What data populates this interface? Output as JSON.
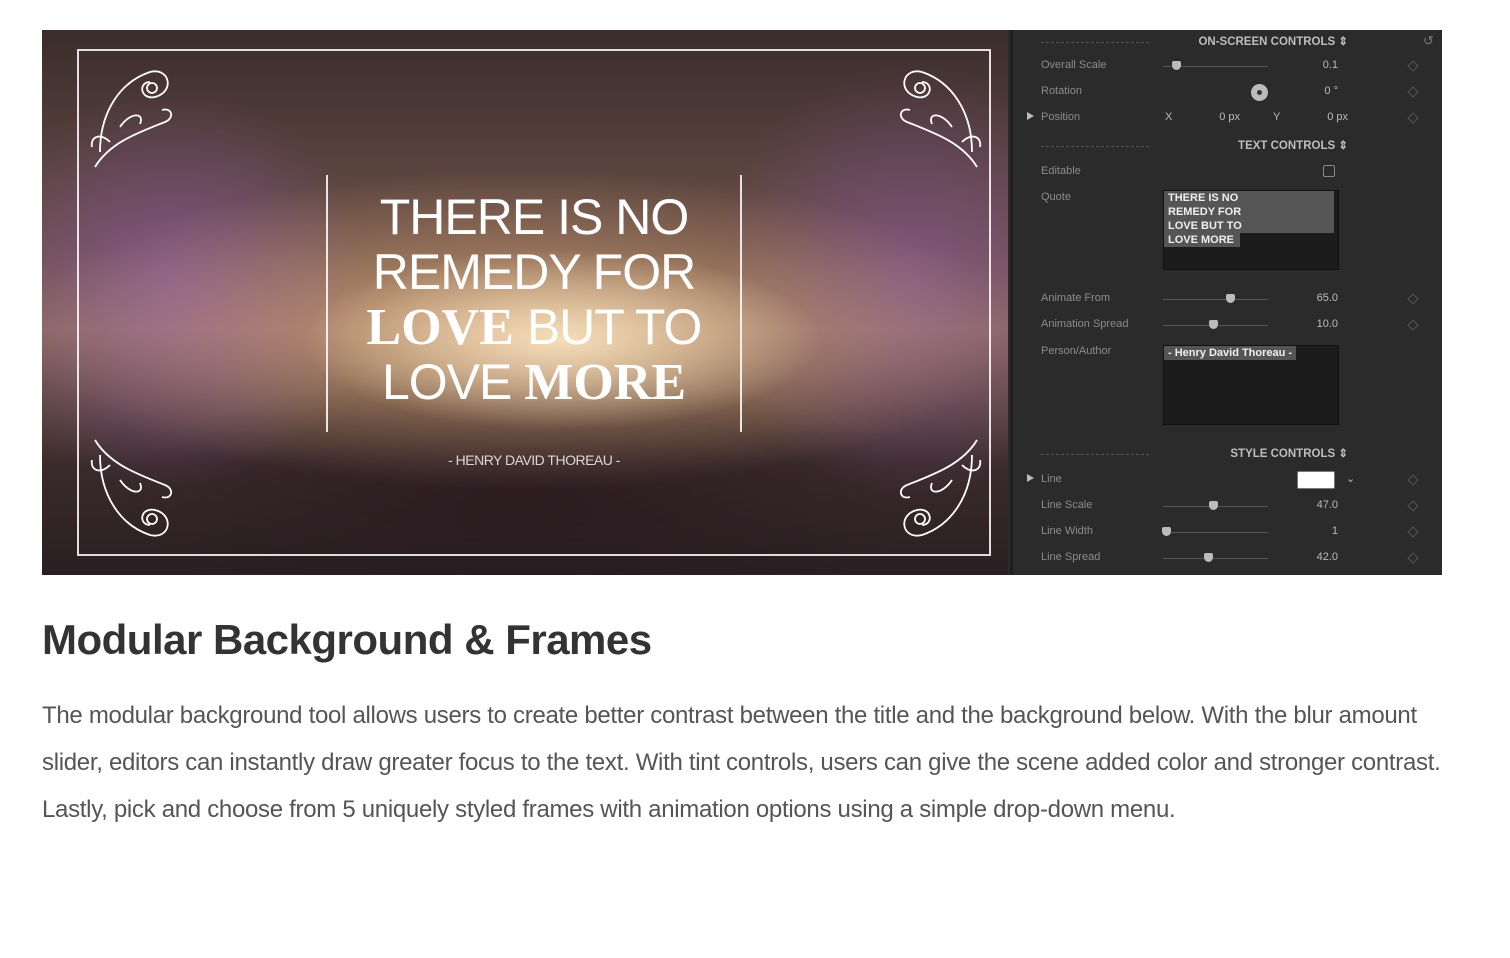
{
  "preview": {
    "quote_lines": [
      {
        "light": "THERE IS NO",
        "bold": ""
      },
      {
        "light": "REMEDY FOR",
        "bold": ""
      },
      {
        "bold": "LOVE",
        "light": " BUT TO"
      },
      {
        "light": "LOVE ",
        "bold": "MORE"
      }
    ],
    "author": "- HENRY DAVID THOREAU -"
  },
  "panel": {
    "on_screen": {
      "title": "ON-SCREEN CONTROLS ⇕",
      "reset_icon": "undo-icon",
      "overall_scale": {
        "label": "Overall Scale",
        "value": "0.1",
        "level": 0.12
      },
      "rotation": {
        "label": "Rotation",
        "value": "0 °"
      },
      "position": {
        "label": "Position",
        "x_label": "X",
        "x_value": "0 px",
        "y_label": "Y",
        "y_value": "0 px"
      }
    },
    "text": {
      "title": "TEXT CONTROLS ⇕",
      "editable": {
        "label": "Editable",
        "checked": false
      },
      "quote": {
        "label": "Quote",
        "lines": [
          "THERE IS NO",
          "REMEDY FOR",
          "LOVE BUT TO",
          "LOVE MORE"
        ]
      },
      "animate_from": {
        "label": "Animate From",
        "value": "65.0",
        "level": 0.64
      },
      "animation_spread": {
        "label": "Animation Spread",
        "value": "10.0",
        "level": 0.48
      },
      "author": {
        "label": "Person/Author",
        "value": "- Henry David Thoreau -"
      }
    },
    "style": {
      "title": "STYLE CONTROLS ⇕",
      "line": {
        "label": "Line",
        "color": "#ffffff"
      },
      "line_scale": {
        "label": "Line Scale",
        "value": "47.0",
        "level": 0.48
      },
      "line_width": {
        "label": "Line Width",
        "value": "1",
        "level": 0.03
      },
      "line_spread": {
        "label": "Line Spread",
        "value": "42.0",
        "level": 0.43
      }
    }
  },
  "article": {
    "title": "Modular Background & Frames",
    "body": "The modular background tool allows users to create better contrast between the title and the background below.  With the blur amount slider, editors can instantly draw greater focus to the text. With tint controls, users can give the scene added color and stronger contrast.  Lastly, pick and choose from 5 uniquely styled frames with animation options using a simple drop-down menu."
  }
}
